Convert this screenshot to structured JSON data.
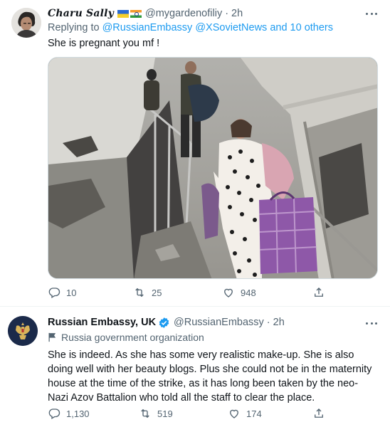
{
  "tweets": [
    {
      "display_name": "Charu Sally",
      "flags": [
        "ukraine-flag",
        "india-flag"
      ],
      "handle": "@mygardenofiliy",
      "separator": "·",
      "time": "2h",
      "replying_prefix": "Replying to",
      "replying_mentions": "@RussianEmbassy @XSovietNews",
      "replying_suffix": "and 10 others",
      "text": "She is pregnant you mf !",
      "actions": {
        "reply_count": "10",
        "retweet_count": "25",
        "like_count": "948"
      },
      "media_icon": "photo"
    },
    {
      "display_name": "Russian Embassy, UK",
      "verified_icon": "verified-badge-icon",
      "handle": "@RussianEmbassy",
      "separator": "·",
      "time": "2h",
      "affiliation": "Russia government organization",
      "text": "She is indeed. As she has some very realistic make-up. She is also doing well with her beauty blogs. Plus she could not be in the maternity house at the time of the strike, as it has long been taken by the neo-Nazi Azov Battalion who told all the staff to clear the place.",
      "actions": {
        "reply_count": "1,130",
        "retweet_count": "519",
        "like_count": "174"
      }
    }
  ],
  "colors": {
    "accent": "#1d9bf0",
    "secondary_text": "#536471",
    "primary_text": "#0f1419",
    "divider": "#eff3f4"
  }
}
